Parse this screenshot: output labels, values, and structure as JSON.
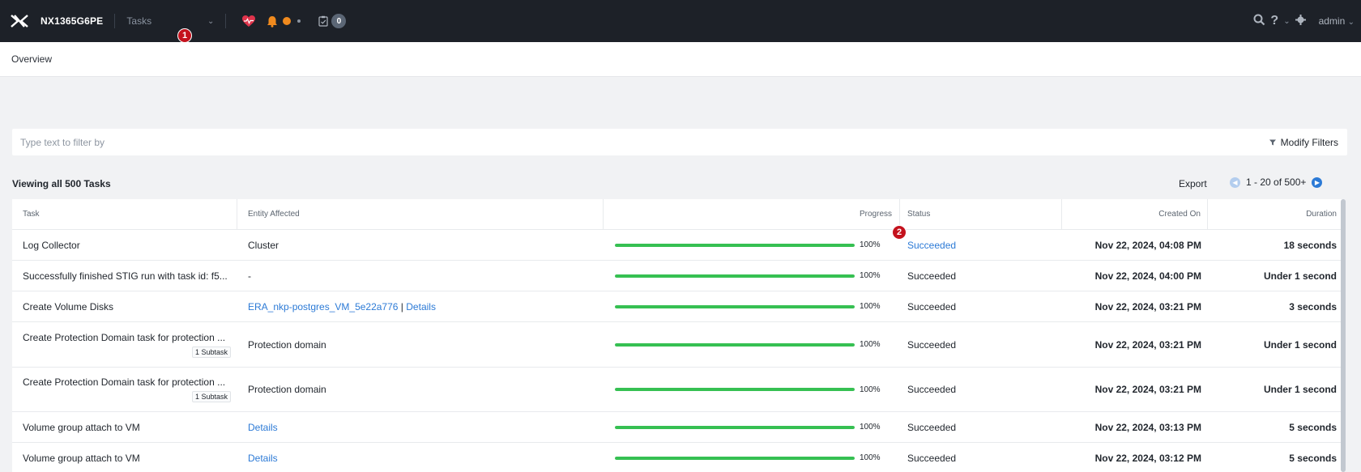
{
  "header": {
    "cluster_name": "NX1365G6PE",
    "nav_selected": "Tasks",
    "task_count": "0",
    "user": "admin",
    "badge1": "1",
    "badge2": "2"
  },
  "breadcrumb": "Overview",
  "filter": {
    "placeholder": "Type text to filter by",
    "modify_label": "Modify Filters"
  },
  "summary": "Viewing all 500 Tasks",
  "export_label": "Export",
  "pager": "1 - 20 of 500+",
  "table": {
    "columns": [
      "Task",
      "Entity Affected",
      "Progress",
      "Status",
      "Created On",
      "Duration"
    ],
    "rows": [
      {
        "task": "Log Collector",
        "entity": "Cluster",
        "progress": 100,
        "progress_label": "100%",
        "status": "Succeeded",
        "created": "Nov 22, 2024, 04:08 PM",
        "duration": "18 seconds"
      },
      {
        "task": "Successfully finished STIG run with task id: f5...",
        "entity": "-",
        "progress": 100,
        "progress_label": "100%",
        "status": "Succeeded",
        "created": "Nov 22, 2024, 04:00 PM",
        "duration": "Under 1 second"
      },
      {
        "task": "Create Volume Disks",
        "entity_link": "ERA_nkp-postgres_VM_5e22a776",
        "entity_sep": " | ",
        "entity_details": "Details",
        "progress": 100,
        "progress_label": "100%",
        "status": "Succeeded",
        "created": "Nov 22, 2024, 03:21 PM",
        "duration": "3 seconds"
      },
      {
        "task": "Create Protection Domain task for protection ...",
        "subtask": "1 Subtask",
        "entity": "Protection domain",
        "progress": 100,
        "progress_label": "100%",
        "status": "Succeeded",
        "created": "Nov 22, 2024, 03:21 PM",
        "duration": "Under 1 second"
      },
      {
        "task": "Create Protection Domain task for protection ...",
        "subtask": "1 Subtask",
        "entity": "Protection domain",
        "progress": 100,
        "progress_label": "100%",
        "status": "Succeeded",
        "created": "Nov 22, 2024, 03:21 PM",
        "duration": "Under 1 second"
      },
      {
        "task": "Volume group attach to VM",
        "entity_details": "Details",
        "progress": 100,
        "progress_label": "100%",
        "status": "Succeeded",
        "created": "Nov 22, 2024, 03:13 PM",
        "duration": "5 seconds"
      },
      {
        "task": "Volume group attach to VM",
        "entity_details": "Details",
        "progress": 100,
        "progress_label": "100%",
        "status": "Succeeded",
        "created": "Nov 22, 2024, 03:12 PM",
        "duration": "5 seconds"
      }
    ]
  },
  "colors": {
    "accent": "#2c7ad6",
    "progress": "#36c052",
    "topbar": "#1d2128",
    "badge": "#c4121d",
    "alert": "#f08a1e",
    "health": "#e0344c"
  },
  "icons": [
    "nutanix-logo-icon",
    "heart-health-icon",
    "bell-icon",
    "tasks-icon",
    "search-icon",
    "help-icon",
    "gear-icon",
    "filter-icon",
    "chevron-down-icon"
  ]
}
